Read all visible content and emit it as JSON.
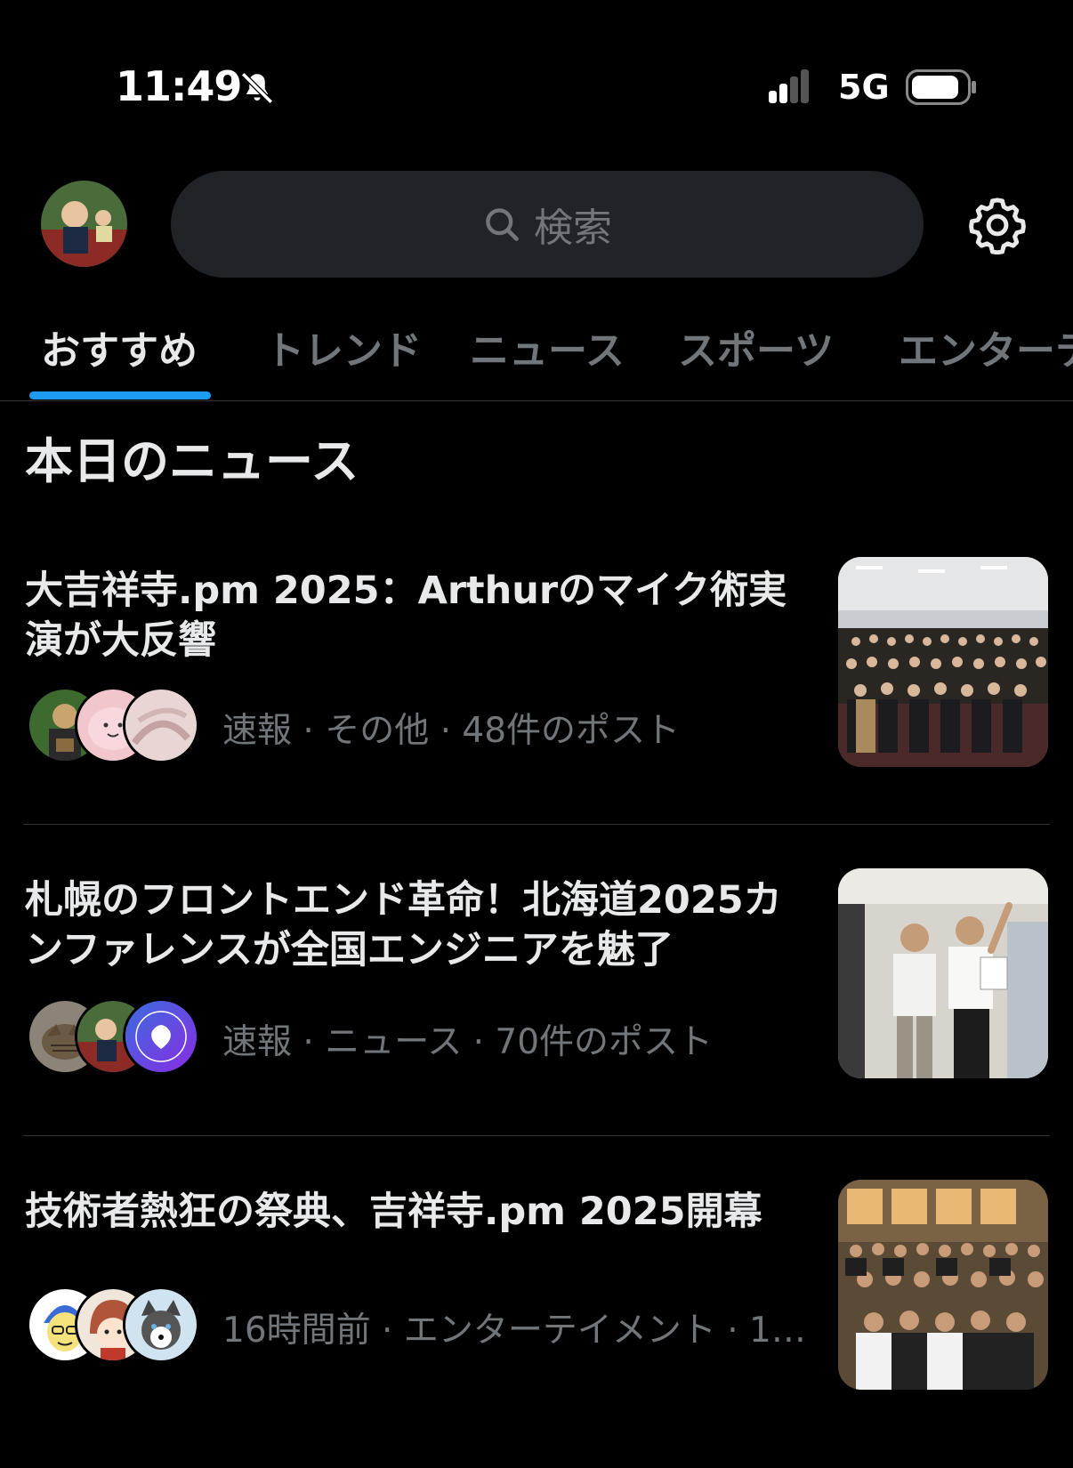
{
  "status_bar": {
    "time": "11:49",
    "network": "5G"
  },
  "search": {
    "placeholder": "検索"
  },
  "tabs": [
    {
      "label": "おすすめ",
      "active": true
    },
    {
      "label": "トレンド",
      "active": false
    },
    {
      "label": "ニュース",
      "active": false
    },
    {
      "label": "スポーツ",
      "active": false
    },
    {
      "label": "エンターテ",
      "active": false
    }
  ],
  "section": {
    "title": "本日のニュース"
  },
  "news": [
    {
      "title": "大吉祥寺.pm 2025：Arthurのマイク術実演が大反響",
      "meta": "速報 · その他 · 48件のポスト"
    },
    {
      "title": "札幌のフロントエンド革命！北海道2025カンファレンスが全国エンジニアを魅了",
      "meta": "速報 · ニュース · 70件のポスト"
    },
    {
      "title": "技術者熱狂の祭典、吉祥寺.pm 2025開幕",
      "meta": "16時間前 · エンターテイメント · 1…"
    }
  ],
  "colors": {
    "background": "#000000",
    "accent": "#1d9bf0",
    "text_primary": "#e7e9ea",
    "text_secondary": "#71767b",
    "search_bg": "#202327"
  }
}
